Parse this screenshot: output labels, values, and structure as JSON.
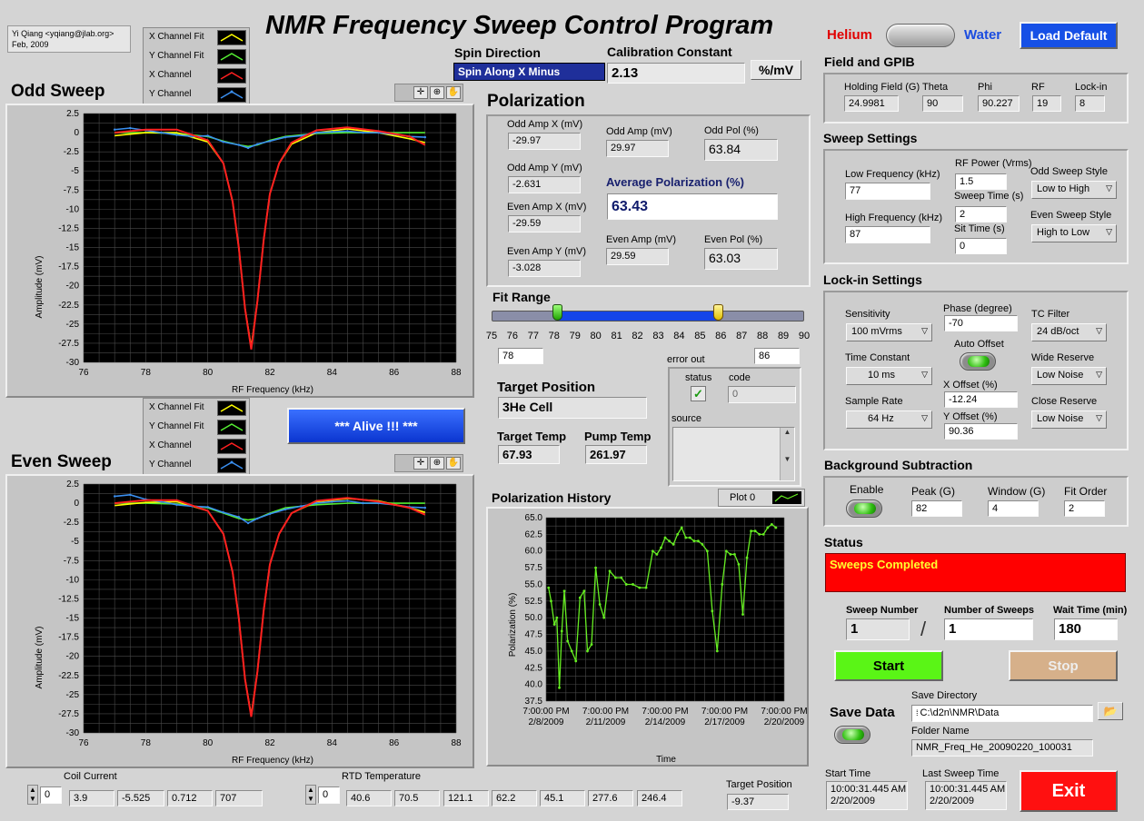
{
  "header": {
    "author_line1": "Yi Qiang <yqiang@jlab.org>",
    "author_line2": "Feb, 2009",
    "title": "NMR Frequency Sweep Control Program",
    "helium_label": "Helium",
    "water_label": "Water",
    "load_default_label": "Load Default"
  },
  "spin": {
    "label": "Spin Direction",
    "value": "Spin Along X Minus"
  },
  "calibration": {
    "label": "Calibration Constant",
    "value": "2.13",
    "unit": "%/mV"
  },
  "legend": {
    "items": [
      "X Channel Fit",
      "Y Channel Fit",
      "X Channel",
      "Y Channel"
    ],
    "colors": [
      "#ffff00",
      "#55ee33",
      "#ff2020",
      "#3a8ff0"
    ]
  },
  "odd_sweep": {
    "title": "Odd Sweep",
    "xlabel": "RF Frequency (kHz)",
    "ylabel": "Amplitude (mV)"
  },
  "even_sweep": {
    "title": "Even Sweep",
    "xlabel": "RF Frequency (kHz)",
    "ylabel": "Amplitude (mV)"
  },
  "sweep_axes": {
    "x_ticks": [
      "76",
      "78",
      "80",
      "82",
      "84",
      "86",
      "88"
    ],
    "y_ticks": [
      "2.5",
      "0",
      "-2.5",
      "-5",
      "-7.5",
      "-10",
      "-12.5",
      "-15",
      "-17.5",
      "-20",
      "-22.5",
      "-25",
      "-27.5",
      "-30"
    ]
  },
  "alive_label": "*** Alive !!! ***",
  "polarization": {
    "title": "Polarization",
    "odd_amp_x_label": "Odd Amp X (mV)",
    "odd_amp_x": "-29.97",
    "odd_amp_y_label": "Odd Amp Y (mV)",
    "odd_amp_y": "-2.631",
    "even_amp_x_label": "Even Amp X (mV)",
    "even_amp_x": "-29.59",
    "even_amp_y_label": "Even Amp Y (mV)",
    "even_amp_y": "-3.028",
    "odd_amp_label": "Odd Amp (mV)",
    "odd_amp": "29.97",
    "odd_pol_label": "Odd Pol (%)",
    "odd_pol": "63.84",
    "avg_label": "Average Polarization (%)",
    "avg": "63.43",
    "even_amp_label": "Even Amp (mV)",
    "even_amp": "29.59",
    "even_pol_label": "Even Pol (%)",
    "even_pol": "63.03"
  },
  "fit_range": {
    "title": "Fit Range",
    "ticks": [
      "75",
      "76",
      "77",
      "78",
      "79",
      "80",
      "81",
      "82",
      "83",
      "84",
      "85",
      "86",
      "87",
      "88",
      "89",
      "90"
    ],
    "low": "78",
    "high": "86"
  },
  "error_out": {
    "label": "error out",
    "status_label": "status",
    "code_label": "code",
    "code_value": "0",
    "source_label": "source"
  },
  "target": {
    "position_label": "Target Position",
    "position_value": "3He Cell",
    "temp_label": "Target Temp",
    "temp_value": "67.93",
    "pump_label": "Pump Temp",
    "pump_value": "261.97"
  },
  "history": {
    "title": "Polarization History",
    "plot_label": "Plot 0",
    "xlabel": "Time",
    "ylabel": "Polarization (%)"
  },
  "field_gpib": {
    "title": "Field and GPIB",
    "holding_label": "Holding Field (G)",
    "holding": "24.9981",
    "theta_label": "Theta",
    "theta": "90",
    "phi_label": "Phi",
    "phi": "90.227",
    "rf_label": "RF",
    "rf": "19",
    "lockin_label": "Lock-in",
    "lockin": "8"
  },
  "sweep_settings": {
    "title": "Sweep Settings",
    "low_freq_label": "Low Frequency (kHz)",
    "low_freq": "77",
    "high_freq_label": "High Frequency (kHz)",
    "high_freq": "87",
    "rf_power_label": "RF Power (Vrms)",
    "rf_power": "1.5",
    "sweep_time_label": "Sweep Time (s)",
    "sweep_time": "2",
    "sit_time_label": "Sit Time (s)",
    "sit_time": "0",
    "odd_style_label": "Odd Sweep Style",
    "odd_style": "Low to High",
    "even_style_label": "Even Sweep Style",
    "even_style": "High to Low"
  },
  "lockin": {
    "title": "Lock-in Settings",
    "sensitivity_label": "Sensitivity",
    "sensitivity": "100 mVrms",
    "time_const_label": "Time Constant",
    "time_const": "10 ms",
    "sample_rate_label": "Sample Rate",
    "sample_rate": "64 Hz",
    "phase_label": "Phase (degree)",
    "phase": "-70",
    "auto_offset_label": "Auto Offset",
    "x_offset_label": "X Offset (%)",
    "x_offset": "-12.24",
    "y_offset_label": "Y Offset (%)",
    "y_offset": "90.36",
    "tc_filter_label": "TC Filter",
    "tc_filter": "24 dB/oct",
    "wide_label": "Wide Reserve",
    "wide": "Low Noise",
    "close_label": "Close Reserve",
    "close": "Low Noise"
  },
  "background": {
    "title": "Background Subtraction",
    "enable_label": "Enable",
    "peak_label": "Peak (G)",
    "peak": "82",
    "window_label": "Window (G)",
    "window": "4",
    "order_label": "Fit Order",
    "order": "2"
  },
  "status": {
    "title": "Status",
    "message": "Sweeps Completed",
    "sweep_number_label": "Sweep Number",
    "sweep_number": "1",
    "slash": "/",
    "num_sweeps_label": "Number of Sweeps",
    "num_sweeps": "1",
    "wait_label": "Wait Time (min)",
    "wait": "180",
    "start_label": "Start",
    "stop_label": "Stop"
  },
  "save": {
    "label": "Save Data",
    "dir_label": "Save Directory",
    "dir": "C:\\d2n\\NMR\\Data",
    "folder_label": "Folder Name",
    "folder": "NMR_Freq_He_20090220_100031"
  },
  "times": {
    "start_label": "Start Time",
    "start_time": "10:00:31.445 AM",
    "start_date": "2/20/2009",
    "last_label": "Last Sweep Time",
    "last_time": "10:00:31.445 AM",
    "last_date": "2/20/2009",
    "exit_label": "Exit"
  },
  "coil": {
    "label": "Coil Current",
    "index": "0",
    "values": [
      "3.9",
      "-5.525",
      "0.712",
      "707"
    ]
  },
  "rtd": {
    "label": "RTD Temperature",
    "index": "0",
    "values": [
      "40.6",
      "70.5",
      "121.1",
      "62.2",
      "45.1",
      "277.6",
      "246.4"
    ]
  },
  "target_position_readout": {
    "label": "Target Position",
    "value": "-9.37"
  },
  "chart_data": [
    {
      "type": "line",
      "name": "odd-sweep",
      "title": "Odd Sweep",
      "xlabel": "RF Frequency (kHz)",
      "ylabel": "Amplitude (mV)",
      "xlim": [
        76,
        88
      ],
      "ylim": [
        -30,
        2.5
      ],
      "series": [
        {
          "name": "X Channel Fit",
          "color": "#ffff00",
          "x": [
            77,
            78,
            79,
            80,
            80.5,
            80.8,
            81,
            81.2,
            81.4,
            81.6,
            81.8,
            82,
            82.3,
            82.7,
            83.5,
            84.5,
            85.5,
            86.5,
            87
          ],
          "y": [
            -0.4,
            0,
            0,
            -1.2,
            -4,
            -9,
            -15,
            -23,
            -28,
            -22,
            -14,
            -8,
            -4,
            -1.5,
            0,
            0.5,
            0,
            -0.8,
            -1.3
          ]
        },
        {
          "name": "X Channel",
          "color": "#ff2020",
          "x": [
            77,
            78,
            79,
            80,
            80.5,
            80.8,
            81,
            81.2,
            81.4,
            81.6,
            81.8,
            82,
            82.3,
            82.7,
            83.5,
            84.5,
            85.5,
            86.5,
            87
          ],
          "y": [
            0,
            0.4,
            0.4,
            -1,
            -4,
            -9,
            -15,
            -23,
            -28.3,
            -22,
            -14,
            -8,
            -4,
            -1.3,
            0.3,
            0.7,
            0.2,
            -0.5,
            -1.6
          ]
        },
        {
          "name": "Y Channel Fit",
          "color": "#55ee33",
          "x": [
            77,
            78,
            79,
            80,
            80.5,
            81,
            81.3,
            81.6,
            82,
            82.5,
            83.5,
            84.5,
            85.5,
            86.5,
            87
          ],
          "y": [
            0,
            0,
            -0.1,
            -0.5,
            -1.1,
            -1.6,
            -1.8,
            -1.6,
            -1,
            -0.5,
            -0.1,
            0,
            0,
            0,
            0
          ]
        },
        {
          "name": "Y Channel",
          "color": "#3a8ff0",
          "x": [
            77,
            77.5,
            78,
            78.5,
            79,
            79.5,
            80,
            80.5,
            81,
            81.3,
            81.6,
            82,
            82.5,
            83,
            83.5,
            84,
            84.5,
            85,
            85.5,
            86,
            86.5,
            87
          ],
          "y": [
            0.4,
            0.6,
            0.3,
            0,
            -0.3,
            -0.5,
            -0.4,
            -1.2,
            -1.6,
            -2,
            -1.5,
            -1.1,
            -0.6,
            -0.4,
            0,
            0.1,
            0.2,
            0,
            0,
            -0.2,
            -0.5,
            -0.6
          ]
        }
      ]
    },
    {
      "type": "line",
      "name": "even-sweep",
      "title": "Even Sweep",
      "xlabel": "RF Frequency (kHz)",
      "ylabel": "Amplitude (mV)",
      "xlim": [
        76,
        88
      ],
      "ylim": [
        -30,
        2.5
      ],
      "series": [
        {
          "name": "X Channel Fit",
          "color": "#ffff00",
          "x": [
            77,
            78,
            79,
            80,
            80.5,
            80.8,
            81,
            81.2,
            81.4,
            81.6,
            81.8,
            82,
            82.3,
            82.7,
            83.5,
            84.5,
            85.5,
            86.5,
            87
          ],
          "y": [
            -0.3,
            0.1,
            0.2,
            -1,
            -4,
            -9,
            -15,
            -23,
            -27.7,
            -22,
            -14,
            -8,
            -4,
            -1.3,
            0.2,
            0.6,
            0.3,
            -0.6,
            -1.2
          ]
        },
        {
          "name": "X Channel",
          "color": "#ff2020",
          "x": [
            77,
            78,
            79,
            80,
            80.5,
            80.8,
            81,
            81.2,
            81.4,
            81.6,
            81.8,
            82,
            82.3,
            82.7,
            83.5,
            84.5,
            85.5,
            86.5,
            87
          ],
          "y": [
            0,
            0.4,
            0.4,
            -1,
            -4,
            -9,
            -15,
            -23,
            -27.9,
            -22,
            -14,
            -8,
            -4,
            -1.3,
            0.3,
            0.7,
            0.2,
            -0.6,
            -1.5
          ]
        },
        {
          "name": "Y Channel Fit",
          "color": "#55ee33",
          "x": [
            77,
            78,
            79,
            80,
            80.5,
            81,
            81.3,
            81.6,
            82,
            82.5,
            83.5,
            84.5,
            85.5,
            86.5,
            87
          ],
          "y": [
            0,
            0,
            -0.1,
            -0.6,
            -1.3,
            -2,
            -2.2,
            -2,
            -1.3,
            -0.6,
            -0.2,
            0,
            0,
            0,
            0
          ]
        },
        {
          "name": "Y Channel",
          "color": "#3a8ff0",
          "x": [
            77,
            77.5,
            78,
            78.5,
            79,
            79.5,
            80,
            80.5,
            81,
            81.3,
            81.6,
            82,
            82.5,
            83,
            83.5,
            84,
            84.5,
            85,
            85.5,
            86,
            86.5,
            87
          ],
          "y": [
            0.9,
            1.1,
            0.5,
            0.2,
            -0.2,
            -0.4,
            -0.5,
            -1.2,
            -1.8,
            -2.6,
            -2,
            -1.4,
            -0.8,
            -0.4,
            0,
            0.2,
            0.3,
            0,
            0,
            -0.2,
            -0.5,
            -0.6
          ]
        }
      ]
    },
    {
      "type": "line",
      "name": "polarization-history",
      "title": "Polarization History",
      "xlabel": "Time",
      "ylabel": "Polarization (%)",
      "ylim": [
        37.5,
        65
      ],
      "y_ticks": [
        "65.0",
        "62.5",
        "60.0",
        "57.5",
        "55.0",
        "52.5",
        "50.0",
        "47.5",
        "45.0",
        "42.5",
        "40.0",
        "37.5"
      ],
      "x_ticks": [
        [
          "7:00:00 PM",
          "2/8/2009"
        ],
        [
          "7:00:00 PM",
          "2/11/2009"
        ],
        [
          "7:00:00 PM",
          "2/14/2009"
        ],
        [
          "7:00:00 PM",
          "2/17/2009"
        ],
        [
          "7:00:00 PM",
          "2/20/2009"
        ]
      ],
      "xlim": [
        "2009-02-08 19:00",
        "2009-02-20 19:00"
      ],
      "series": [
        {
          "name": "Plot 0",
          "color": "#66ee22",
          "x": [
            "2009-02-08 22:00",
            "2009-02-09 01:00",
            "2009-02-09 05:00",
            "2009-02-09 08:00",
            "2009-02-09 11:00",
            "2009-02-09 14:00",
            "2009-02-09 17:00",
            "2009-02-09 21:00",
            "2009-02-10 02:00",
            "2009-02-10 07:00",
            "2009-02-10 12:00",
            "2009-02-10 17:00",
            "2009-02-10 21:00",
            "2009-02-11 02:00",
            "2009-02-11 07:00",
            "2009-02-11 12:00",
            "2009-02-11 17:00",
            "2009-02-12 00:00",
            "2009-02-12 07:00",
            "2009-02-12 14:00",
            "2009-02-12 20:00",
            "2009-02-13 04:00",
            "2009-02-13 12:00",
            "2009-02-13 20:00",
            "2009-02-14 04:00",
            "2009-02-14 09:00",
            "2009-02-14 14:00",
            "2009-02-14 19:00",
            "2009-02-15 00:00",
            "2009-02-15 05:00",
            "2009-02-15 10:00",
            "2009-02-15 15:00",
            "2009-02-15 20:00",
            "2009-02-16 01:00",
            "2009-02-16 06:00",
            "2009-02-16 11:00",
            "2009-02-16 16:00",
            "2009-02-16 22:00",
            "2009-02-17 04:00",
            "2009-02-17 10:00",
            "2009-02-17 16:00",
            "2009-02-17 21:00",
            "2009-02-18 02:00",
            "2009-02-18 07:00",
            "2009-02-18 12:00",
            "2009-02-18 17:00",
            "2009-02-18 22:00",
            "2009-02-19 03:00",
            "2009-02-19 08:00",
            "2009-02-19 13:00",
            "2009-02-19 18:00",
            "2009-02-19 23:00",
            "2009-02-20 04:00",
            "2009-02-20 09:00"
          ],
          "y": [
            54.5,
            52.5,
            49,
            50,
            39.5,
            48,
            54,
            46.5,
            45,
            43.5,
            53,
            54,
            45,
            46,
            57.5,
            52,
            50,
            57,
            56,
            56,
            55,
            55,
            54.5,
            54.5,
            60,
            59.5,
            60.5,
            62,
            61.5,
            61,
            62.5,
            63.5,
            62,
            62,
            61.5,
            61.5,
            61,
            60,
            51,
            45,
            55,
            60,
            59.5,
            59.5,
            58,
            50.5,
            59,
            63,
            63,
            62.5,
            62.5,
            63.5,
            64,
            63.5
          ]
        }
      ]
    }
  ]
}
